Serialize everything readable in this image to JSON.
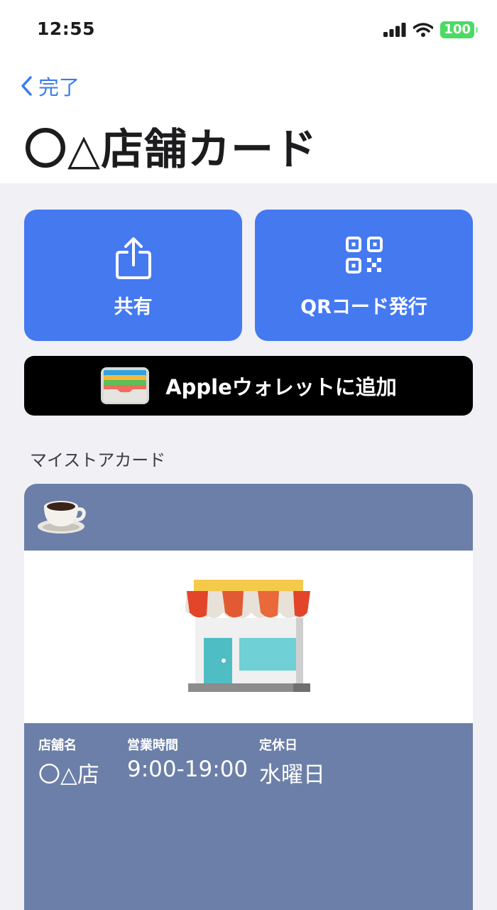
{
  "status_bar": {
    "time": "12:55",
    "battery": "100"
  },
  "nav": {
    "back_label": "完了",
    "title": "〇△店舗カード"
  },
  "actions": {
    "share_label": "共有",
    "qr_label": "QRコード発行",
    "wallet_label": "Appleウォレットに追加"
  },
  "section": {
    "label": "マイストアカード"
  },
  "card": {
    "color": "#6b7fa8",
    "header_icon": "coffee-cup-icon",
    "image_icon": "store-icon",
    "fields": [
      {
        "label": "店舗名",
        "value": "〇△店"
      },
      {
        "label": "営業時間",
        "value": "9:00-19:00"
      },
      {
        "label": "定休日",
        "value": "水曜日"
      }
    ]
  },
  "colors": {
    "accent": "#4479f0",
    "link": "#3a7bf0",
    "wallet_bg": "#000000",
    "battery": "#4cd964"
  }
}
